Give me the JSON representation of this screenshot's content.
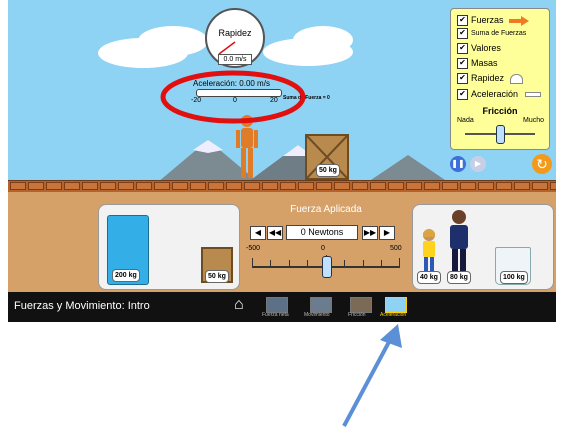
{
  "speedometer": {
    "title": "Rapidez",
    "value": "0.0 m/s"
  },
  "acceleration_meter": {
    "label": "Aceleración:",
    "value": "0.00 m/s",
    "ticks": [
      "-20",
      "0",
      "20"
    ]
  },
  "sum_of_forces_text": "Suma de Fuerza = 0",
  "controls": {
    "items": [
      {
        "label": "Fuerzas",
        "checked": true
      },
      {
        "label": "Suma de Fuerzas",
        "checked": true
      },
      {
        "label": "Valores",
        "checked": true
      },
      {
        "label": "Masas",
        "checked": true
      },
      {
        "label": "Rapidez",
        "checked": true
      },
      {
        "label": "Aceleración",
        "checked": true
      }
    ],
    "friction_title": "Fricción",
    "friction_min": "Nada",
    "friction_max": "Mucho"
  },
  "playground_crate": "50 kg",
  "applied_force": {
    "title": "Fuerza Aplicada",
    "value": "0 Newtons",
    "min": "-500",
    "mid": "0",
    "max": "500",
    "left_buttons": [
      "◀",
      "◀◀"
    ],
    "right_buttons": [
      "▶▶",
      "▶"
    ]
  },
  "left_items": [
    "200 kg",
    "50 kg"
  ],
  "right_items": [
    "40 kg",
    "80 kg",
    "100 kg"
  ],
  "bottom_bar": {
    "title": "Fuerzas y Movimiento: Intro",
    "tabs": [
      "Fuerza neta",
      "Movimiento",
      "Fricción",
      "Aceleración"
    ]
  },
  "colors": {
    "sky": "#8fd3f4",
    "annotation_red": "#e01010",
    "arrow_blue": "#5b8fd6",
    "selected_tab": "#ffd200"
  }
}
